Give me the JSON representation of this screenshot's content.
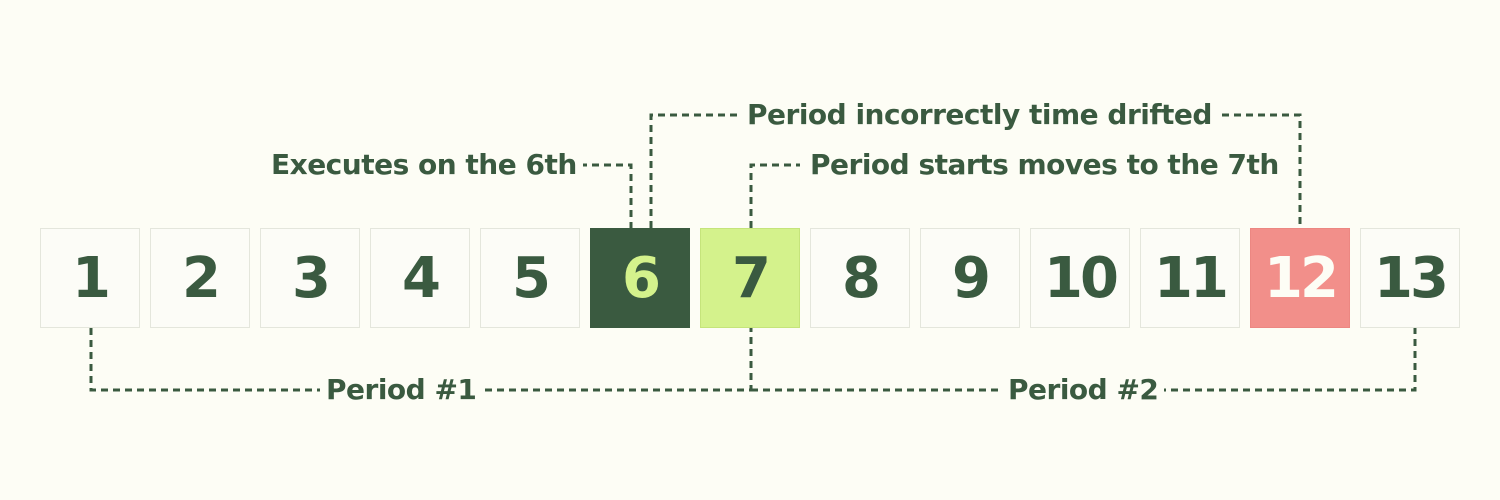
{
  "days": [
    "1",
    "2",
    "3",
    "4",
    "5",
    "6",
    "7",
    "8",
    "9",
    "10",
    "11",
    "12",
    "13"
  ],
  "annotations": {
    "executes": "Executes on the 6th",
    "drift": "Period incorrectly time drifted",
    "period_start": "Period starts moves to the 7th",
    "period_1": "Period #1",
    "period_2": "Period #2"
  },
  "colors": {
    "background": "#fdfdf5",
    "ink": "#3a5a40",
    "executes_day": "#3a5a40",
    "period_start_day": "#d4f28c",
    "drift_end_day": "#f28f8a"
  }
}
